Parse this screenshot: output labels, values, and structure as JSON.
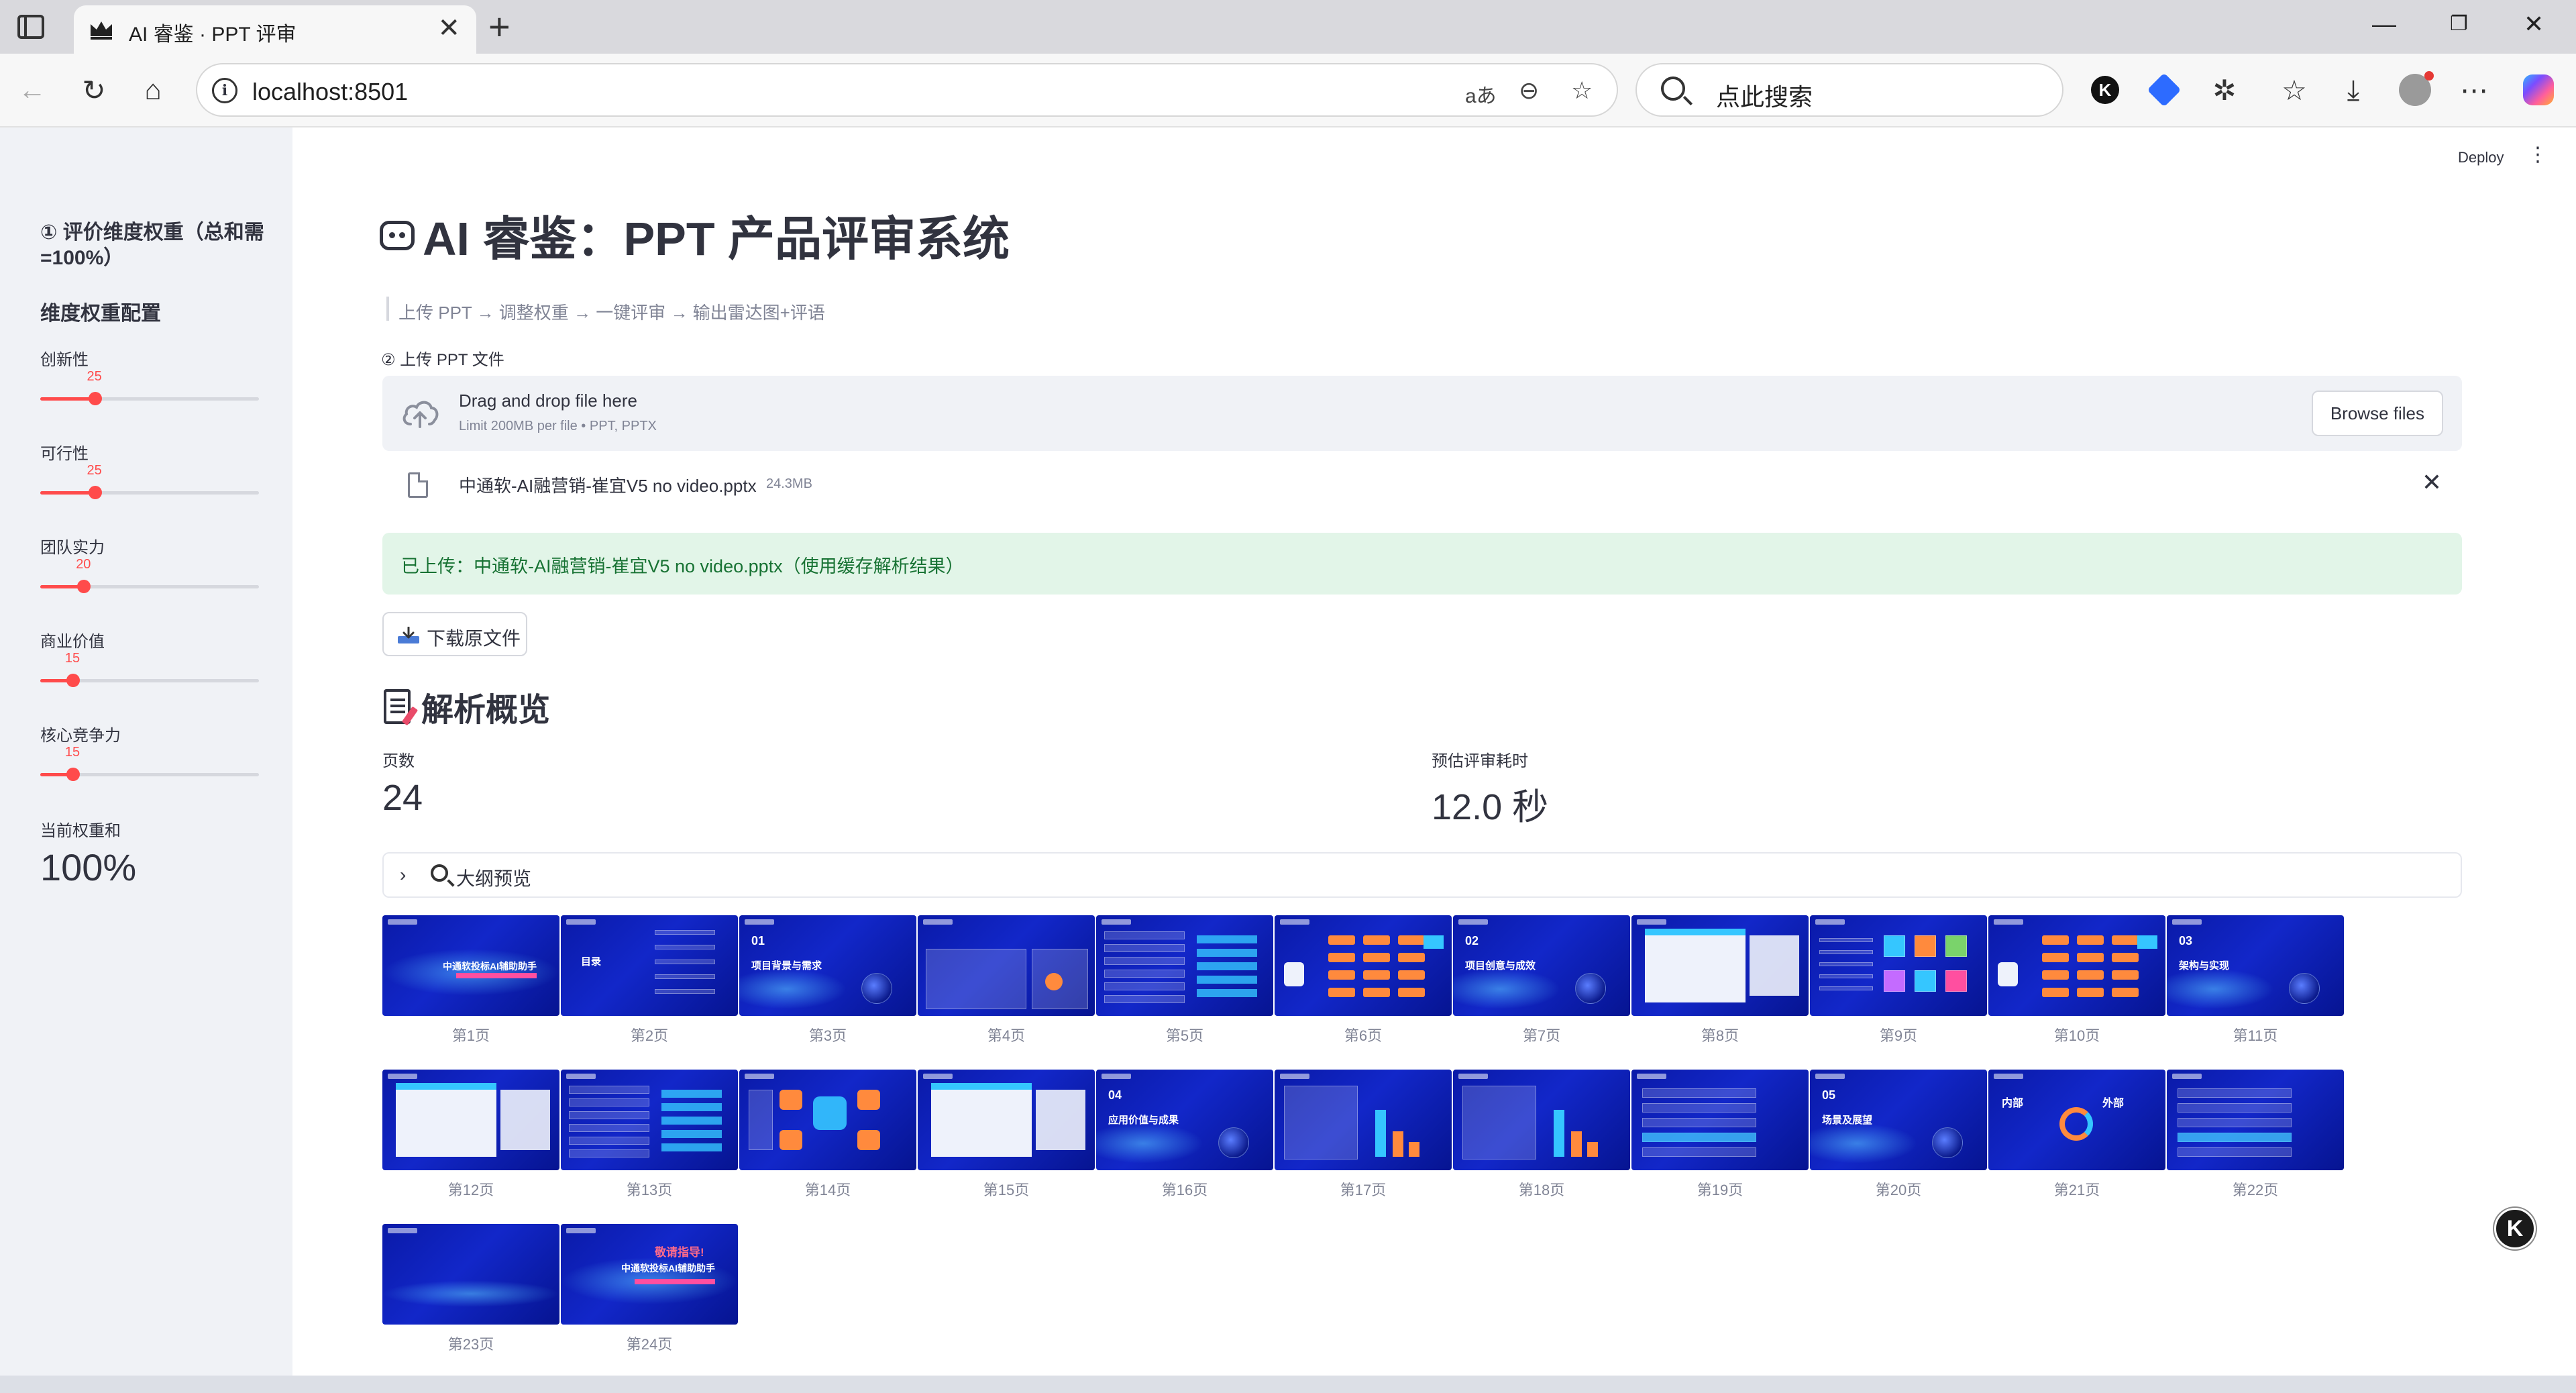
{
  "browser": {
    "tab_title": "AI 睿鉴 · PPT 评审",
    "url": "localhost:8501",
    "search_placeholder": "点此搜索",
    "read_aloud_label": "aあ"
  },
  "app": {
    "deploy_label": "Deploy",
    "title": "AI 睿鉴：PPT 产品评审系统",
    "caption": "上传 PPT → 调整权重 → 一键评审 → 输出雷达图+评语"
  },
  "sidebar": {
    "title": "① 评价维度权重（总和需=100%）",
    "subtitle": "维度权重配置",
    "sliders": [
      {
        "label": "创新性",
        "value": 25,
        "max": 100
      },
      {
        "label": "可行性",
        "value": 25,
        "max": 100
      },
      {
        "label": "团队实力",
        "value": 20,
        "max": 100
      },
      {
        "label": "商业价值",
        "value": 15,
        "max": 100
      },
      {
        "label": "核心竞争力",
        "value": 15,
        "max": 100
      }
    ],
    "total_label": "当前权重和",
    "total_value": "100%"
  },
  "upload": {
    "label": "② 上传 PPT 文件",
    "drop_title": "Drag and drop file here",
    "drop_limit": "Limit 200MB per file • PPT, PPTX",
    "browse_label": "Browse files",
    "file_name": "中通软-AI融营销-崔宜V5 no video.pptx",
    "file_size": "24.3MB",
    "success_message": "已上传：中通软-AI融营销-崔宜V5 no video.pptx（使用缓存解析结果）",
    "download_label": "下载原文件"
  },
  "overview": {
    "title": "解析概览",
    "pages_label": "页数",
    "pages_value": "24",
    "time_label": "预估评审耗时",
    "time_value": "12.0 秒",
    "outline_label": "大纲预览"
  },
  "thumbnails": [
    {
      "caption": "第1页",
      "text": "中通软投标AI辅助助手",
      "kind": "cover"
    },
    {
      "caption": "第2页",
      "text": "目录",
      "kind": "toc"
    },
    {
      "caption": "第3页",
      "text": "项目背景与需求",
      "num": "01",
      "kind": "section"
    },
    {
      "caption": "第4页",
      "kind": "chart"
    },
    {
      "caption": "第5页",
      "kind": "table"
    },
    {
      "caption": "第6页",
      "kind": "flow"
    },
    {
      "caption": "第7页",
      "text": "项目创意与成效",
      "num": "02",
      "kind": "section"
    },
    {
      "caption": "第8页",
      "kind": "screen"
    },
    {
      "caption": "第9页",
      "kind": "icons"
    },
    {
      "caption": "第10页",
      "kind": "flow"
    },
    {
      "caption": "第11页",
      "text": "架构与实现",
      "num": "03",
      "kind": "section"
    },
    {
      "caption": "第12页",
      "kind": "screen"
    },
    {
      "caption": "第13页",
      "kind": "table"
    },
    {
      "caption": "第14页",
      "kind": "hex"
    },
    {
      "caption": "第15页",
      "kind": "screen"
    },
    {
      "caption": "第16页",
      "text": "应用价值与成果",
      "num": "04",
      "kind": "section"
    },
    {
      "caption": "第17页",
      "kind": "bars"
    },
    {
      "caption": "第18页",
      "kind": "bars"
    },
    {
      "caption": "第19页",
      "kind": "list"
    },
    {
      "caption": "第20页",
      "text": "场景及展望",
      "num": "05",
      "kind": "section"
    },
    {
      "caption": "第21页",
      "text": "内部",
      "text2": "外部",
      "kind": "cycle"
    },
    {
      "caption": "第22页",
      "kind": "list"
    },
    {
      "caption": "第23页",
      "kind": "blank"
    },
    {
      "caption": "第24页",
      "text": "中通软投标AI辅助助手",
      "text2": "敬请指导!",
      "kind": "cover"
    }
  ],
  "colors": {
    "accent": "#ff4b4b",
    "success_text": "#177233",
    "slide_bg": "#1227c9"
  }
}
